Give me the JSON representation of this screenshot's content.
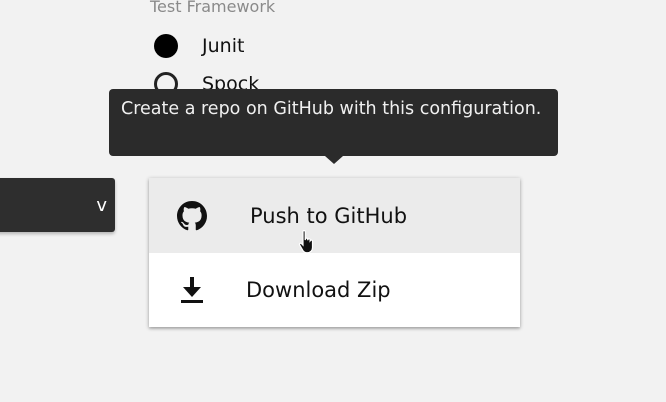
{
  "form": {
    "framework_label": "Test Framework",
    "options": [
      {
        "label": "Junit",
        "checked": true
      },
      {
        "label": "Spock",
        "checked": false
      }
    ]
  },
  "left_button": {
    "label": "v"
  },
  "tooltip": {
    "text": "Create a repo on GitHub with this configuration."
  },
  "menu": {
    "items": [
      {
        "label": "Push to GitHub",
        "icon": "github-icon"
      },
      {
        "label": "Download Zip",
        "icon": "download-icon"
      }
    ]
  },
  "colors": {
    "background": "#f2f2f2",
    "tooltip_bg": "#2b2b2b",
    "menu_hover": "#ebebeb"
  }
}
